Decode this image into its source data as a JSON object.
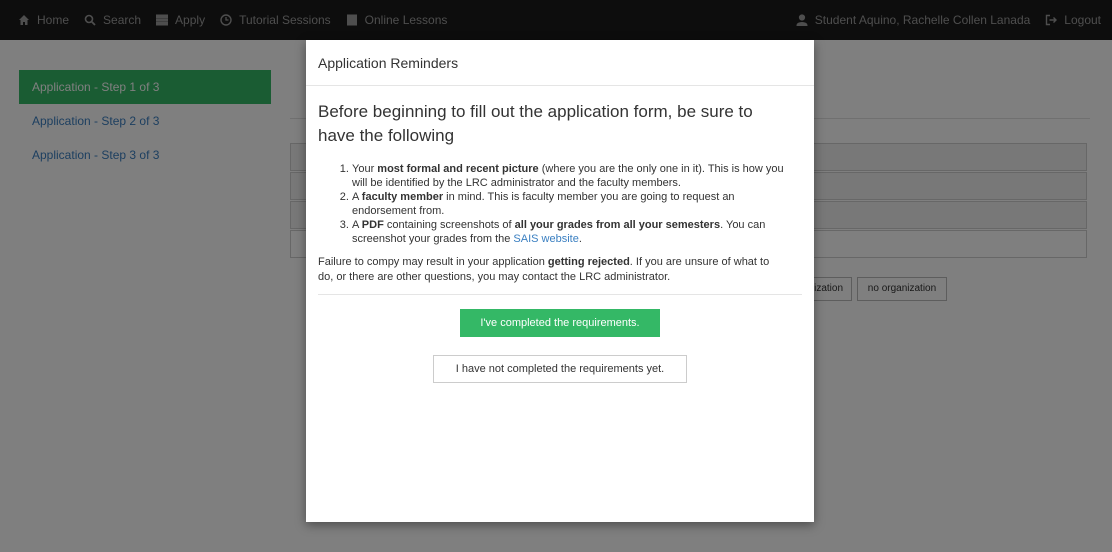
{
  "navbar": {
    "left": [
      {
        "label": "Home",
        "icon": "home-icon"
      },
      {
        "label": "Search",
        "icon": "search-icon"
      },
      {
        "label": "Apply",
        "icon": "list-icon"
      },
      {
        "label": "Tutorial Sessions",
        "icon": "clock-icon"
      },
      {
        "label": "Online Lessons",
        "icon": "book-icon"
      }
    ],
    "right": [
      {
        "label": "Student Aquino, Rachelle Collen Lanada",
        "icon": "user-icon"
      },
      {
        "label": "Logout",
        "icon": "logout-icon"
      }
    ]
  },
  "sidebar": {
    "items": [
      {
        "label": "Application - Step 1 of 3",
        "active": true
      },
      {
        "label": "Application - Step 2 of 3",
        "active": false
      },
      {
        "label": "Application - Step 3 of 3",
        "active": false
      }
    ]
  },
  "background": {
    "org_button_partial": "ization",
    "no_org_button": "no organization"
  },
  "modal": {
    "title": "Application Reminders",
    "heading": "Before beginning to fill out the application form, be sure to have the following",
    "req1_pre": "Your ",
    "req1_bold": "most formal and recent picture",
    "req1_post": " (where you are the only one in it). This is how you will be identified by the LRC administrator and the faculty members.",
    "req2_pre": "A ",
    "req2_bold": "faculty member",
    "req2_post": " in mind. This is faculty member you are going to request an endorsement from.",
    "req3_pre": "A ",
    "req3_bold1": "PDF",
    "req3_mid": " containing screenshots of ",
    "req3_bold2": "all your grades from all your semesters",
    "req3_post": ". You can screenshot your grades from the ",
    "req3_link": "SAIS website",
    "req3_end": ".",
    "warn_pre": "Failure to compy may result in your application ",
    "warn_bold": "getting rejected",
    "warn_post": ". If you are unsure of what to do, or there are other questions, you may contact the LRC administrator.",
    "btn_done": "I've completed the requirements.",
    "btn_not": "I have not completed the requirements yet."
  },
  "colors": {
    "navbar_bg": "#1a1a1a",
    "accent_green": "#34b866",
    "link_blue": "#3a7fc1"
  }
}
